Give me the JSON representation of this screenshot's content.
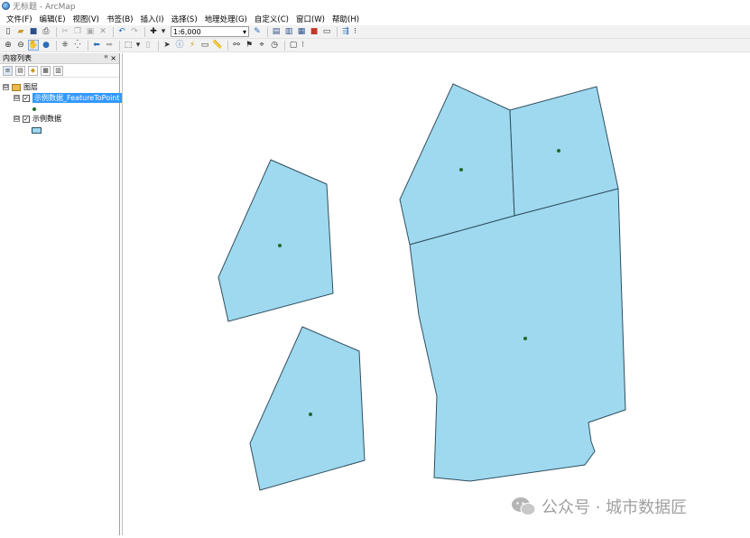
{
  "window": {
    "title": "无标题 - ArcMap"
  },
  "menu": [
    "文件(F)",
    "编辑(E)",
    "视图(V)",
    "书签(B)",
    "插入(I)",
    "选择(S)",
    "地理处理(G)",
    "自定义(C)",
    "窗口(W)",
    "帮助(H)"
  ],
  "toolbar": {
    "scale_value": "1:6,000",
    "scale_arrow": "▾"
  },
  "toc": {
    "title": "内容列表",
    "pin": "ꟸ ×",
    "group_label": "图层",
    "layers": [
      {
        "name": "示例数据_FeatureToPoint",
        "checked": "✓",
        "expander": "⊟"
      },
      {
        "name": "示例数据",
        "checked": "✓",
        "expander": "⊟"
      }
    ],
    "group_expander": "⊟"
  },
  "map": {
    "fill_color": "#9fd9ef",
    "stroke_color": "#2f4f5f",
    "point_color": "#1f6b2a"
  },
  "watermark": {
    "text": "公众号 · 城市数据匠"
  }
}
